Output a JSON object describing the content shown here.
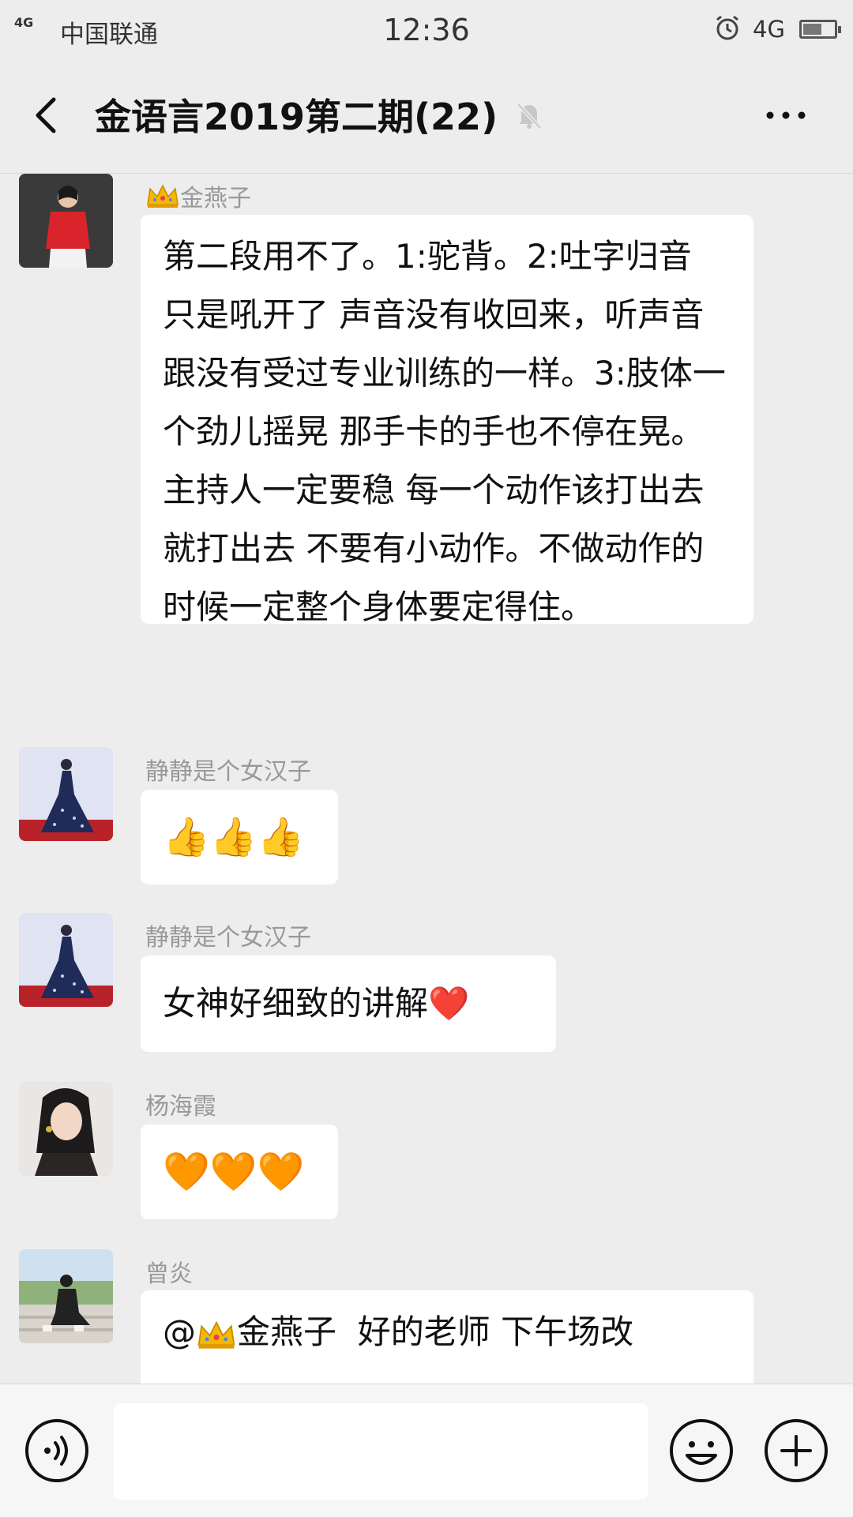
{
  "status_bar": {
    "signal": "4G",
    "carrier": "中国联通",
    "time": "12:36",
    "network": "4G",
    "battery_fraction": 0.6
  },
  "header": {
    "title": "金语言2019第二期(22)",
    "back_icon": "chevron-left-icon",
    "mute_icon": "bell-off-icon",
    "more_icon": "more-dots-icon"
  },
  "messages": [
    {
      "sender": "金燕子",
      "sender_has_crown": true,
      "text": "第二段用不了。1:驼背。2:吐字归音 只是吼开了 声音没有收回来，听声音 跟没有受过专业训练的一样。3:肢体一个劲儿摇晃 那手卡的手也不停在晃。主持人一定要稳 每一个动作该打出去就打出去 不要有小动作。不做动作的时候一定整个身体要定得住。"
    },
    {
      "sender": "静静是个女汉子",
      "text": "👍👍👍"
    },
    {
      "sender": "静静是个女汉子",
      "text": "女神好细致的讲解❤️"
    },
    {
      "sender": "杨海霞",
      "text": "🧡🧡🧡"
    },
    {
      "sender": "曾炎",
      "mention_prefix": "@",
      "mention_name": "金燕子",
      "text": "  好的老师 下午场改"
    }
  ],
  "input_bar": {
    "voice_icon": "voice-icon",
    "emoji_icon": "smiley-icon",
    "plus_icon": "plus-icon",
    "placeholder": ""
  },
  "colors": {
    "background": "#ededed",
    "bubble": "#ffffff",
    "sender_name": "#999999"
  }
}
